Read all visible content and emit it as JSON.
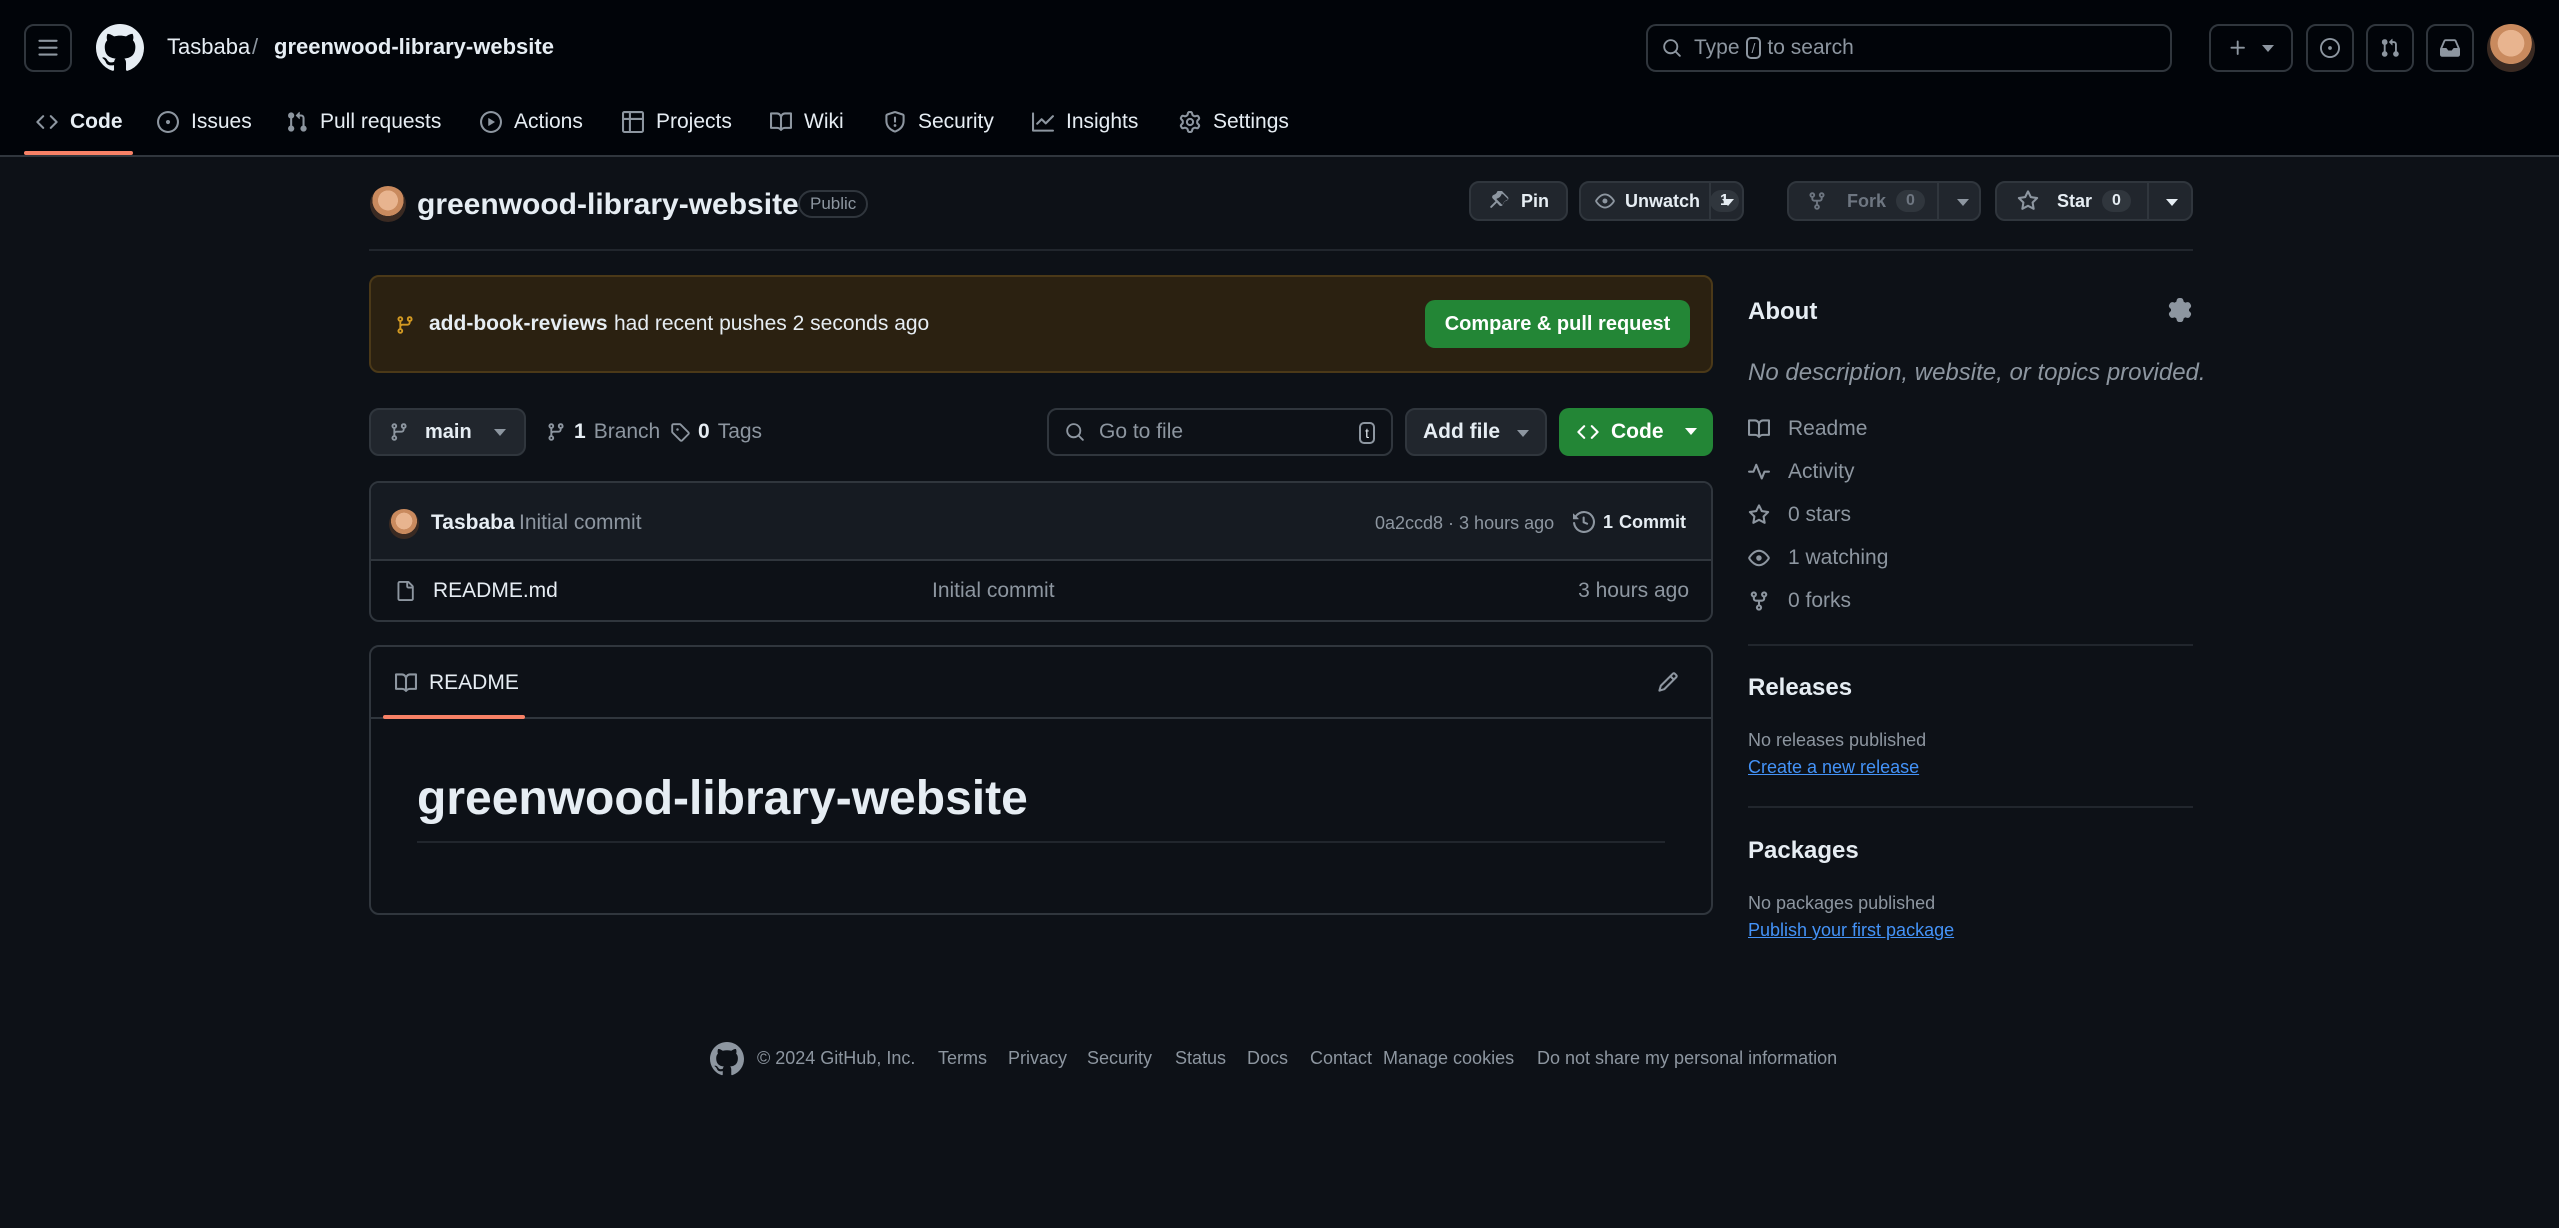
{
  "header": {
    "owner": "Tasbaba",
    "separator": "/",
    "repo": "greenwood-library-website",
    "search_prefix": "Type",
    "search_key": "/",
    "search_suffix": "to search"
  },
  "nav": {
    "tabs": [
      {
        "label": "Code",
        "icon": "code-icon"
      },
      {
        "label": "Issues",
        "icon": "issue-icon"
      },
      {
        "label": "Pull requests",
        "icon": "pull-request-icon"
      },
      {
        "label": "Actions",
        "icon": "play-icon"
      },
      {
        "label": "Projects",
        "icon": "table-icon"
      },
      {
        "label": "Wiki",
        "icon": "book-icon"
      },
      {
        "label": "Security",
        "icon": "shield-icon"
      },
      {
        "label": "Insights",
        "icon": "graph-icon"
      },
      {
        "label": "Settings",
        "icon": "gear-icon"
      }
    ]
  },
  "repo_head": {
    "name": "greenwood-library-website",
    "visibility": "Public",
    "pin_label": "Pin",
    "unwatch_label": "Unwatch",
    "unwatch_count": "1",
    "fork_label": "Fork",
    "fork_count": "0",
    "star_label": "Star",
    "star_count": "0"
  },
  "banner": {
    "branch": "add-book-reviews",
    "message": "had recent pushes 2 seconds ago",
    "button": "Compare & pull request"
  },
  "toolbar": {
    "branch": "main",
    "branch_count": "1",
    "branch_label": "Branch",
    "tag_count": "0",
    "tag_label": "Tags",
    "goto_placeholder": "Go to file",
    "goto_key": "t",
    "add_file": "Add file",
    "code": "Code"
  },
  "commit": {
    "author": "Tasbaba",
    "message": "Initial commit",
    "meta": "0a2ccd8 · 3 hours ago",
    "count": "1",
    "count_label": "Commit"
  },
  "files": [
    {
      "name": "README.md",
      "message": "Initial commit",
      "time": "3 hours ago",
      "icon": "file-icon"
    }
  ],
  "readme": {
    "tab": "README",
    "heading": "greenwood-library-website"
  },
  "sidebar": {
    "about_title": "About",
    "about_desc": "No description, website, or topics provided.",
    "items": [
      {
        "label": "Readme",
        "icon": "book-icon"
      },
      {
        "label": "Activity",
        "icon": "pulse-icon"
      },
      {
        "label": "0 stars",
        "icon": "star-icon"
      },
      {
        "label": "1 watching",
        "icon": "eye-icon"
      },
      {
        "label": "0 forks",
        "icon": "fork-icon"
      }
    ],
    "releases_title": "Releases",
    "releases_text": "No releases published",
    "releases_link": "Create a new release",
    "packages_title": "Packages",
    "packages_text": "No packages published",
    "packages_link": "Publish your first package"
  },
  "footer": {
    "copyright": "© 2024 GitHub, Inc.",
    "links": [
      "Terms",
      "Privacy",
      "Security",
      "Status",
      "Docs",
      "Contact",
      "Manage cookies",
      "Do not share my personal information"
    ]
  },
  "colors": {
    "bg": "#0d1117",
    "header_bg": "#010409",
    "accent_green": "#238636",
    "link_blue": "#4493f8",
    "tab_underline": "#f78166",
    "banner_bg": "#2b2111"
  }
}
